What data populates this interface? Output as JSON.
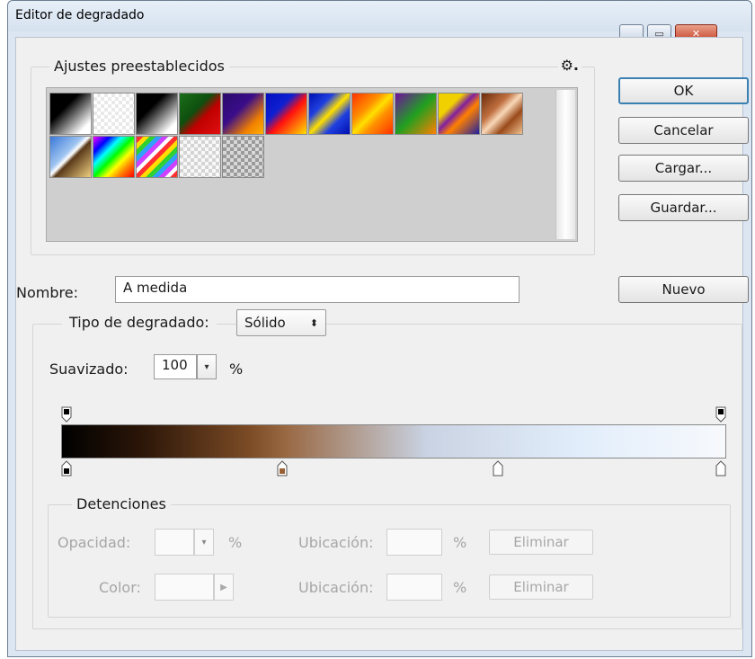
{
  "window": {
    "title": "Editor de degradado"
  },
  "presets": {
    "legend": "Ajustes preestablecidos",
    "swatches": [
      {
        "name": "black-white-preset",
        "bg": "linear-gradient(135deg,#000 35%,#fff 85%)"
      },
      {
        "name": "transparent-preset",
        "bg": "repeating-conic-gradient(#e9e9e9 0 25%, #ffffff 0 50%) 0 0/8px 8px"
      },
      {
        "name": "black-transparent-preset",
        "bg": "linear-gradient(135deg,#000 35%,#ffffff 85%)"
      },
      {
        "name": "red-green-preset",
        "bg": "linear-gradient(135deg,#1a6e1a 0%,#0f4f0f 40%,#c00000 60%,#e01010 100%)"
      },
      {
        "name": "violet-orange-preset",
        "bg": "linear-gradient(135deg,#2a0a6a 0%,#3a0d8a 40%,#f08000 75%,#ffb000 100%)"
      },
      {
        "name": "blue-red-yellow-preset",
        "bg": "linear-gradient(135deg,#0010c0 0%,#1020d0 35%,#ff1010 55%,#ffe000 100%)"
      },
      {
        "name": "blue-yellow-blue-preset",
        "bg": "linear-gradient(135deg,#0010b0 0%,#2040e0 30%,#ffe000 50%,#2040e0 70%,#0010b0 100%)"
      },
      {
        "name": "orange-yellow-orange-preset",
        "bg": "linear-gradient(135deg,#ff3000 0%,#ff9000 35%,#ffe000 50%,#ff9000 65%,#ff3000 100%)"
      },
      {
        "name": "violet-green-orange-preset",
        "bg": "linear-gradient(135deg,#7010a0 0%,#20a020 50%,#ff8000 100%)"
      },
      {
        "name": "yellow-violet-orange-blue-preset",
        "bg": "linear-gradient(135deg,#f0d000 0%,#f0d000 30%,#8020a0 45%,#ff8000 60%,#2020a0 100%)"
      },
      {
        "name": "copper-preset",
        "bg": "linear-gradient(135deg,#6a2a0a 0%,#c07040 35%,#f8d8b8 50%,#9a4a1a 70%,#f0c090 100%)"
      },
      {
        "name": "chrome-preset",
        "bg": "linear-gradient(135deg,#3a78d8 0%,#9fc4f0 40%,#ffffff 48%,#5a3a1a 55%,#f0d080 100%)"
      },
      {
        "name": "spectrum-preset",
        "bg": "linear-gradient(135deg,#ff00ff 0%,#0000ff 20%,#00ffff 35%,#00ff00 50%,#ffff00 65%,#ff8000 80%,#ff0000 100%)"
      },
      {
        "name": "transparent-rainbow-preset",
        "bg": "repeating-linear-gradient(135deg,#ff3030 0 5px,#ffdd00 5px 10px,#30d030 10px 15px,#30a0ff 15px 20px,#d040ff 20px 25px,#ffffff 25px 29px)"
      },
      {
        "name": "transparent-stripes-preset",
        "bg": "repeating-conic-gradient(#d4d4d4 0 25%, #f8f8f8 0 50%) 0 0/8px 8px"
      },
      {
        "name": "neutral-density-preset",
        "bg": "repeating-conic-gradient(#9a9a9a 0 25%, #d8d8d8 0 50%) 0 0/8px 8px"
      }
    ]
  },
  "buttons": {
    "ok": "OK",
    "cancel": "Cancelar",
    "load": "Cargar...",
    "save": "Guardar...",
    "new": "Nuevo"
  },
  "name_field": {
    "label": "Nombre:",
    "value": "A medida"
  },
  "gradient": {
    "type_label": "Tipo de degradado:",
    "type_value": "Sólido",
    "smoothness_label": "Suavizado:",
    "smoothness_value": "100",
    "percent": "%",
    "color_stops": [
      {
        "color": "#000000",
        "position": 0
      },
      {
        "color": "#9a6035",
        "position": 33
      },
      {
        "color": "#ffffff",
        "position": 66
      },
      {
        "color": "#ffffff",
        "position": 100
      }
    ],
    "opacity_stops": [
      {
        "color": "#000000",
        "position": 0
      },
      {
        "color": "#000000",
        "position": 100
      }
    ]
  },
  "stops": {
    "legend": "Detenciones",
    "opacity_label": "Opacidad:",
    "color_label": "Color:",
    "location_label": "Ubicación:",
    "percent": "%",
    "delete_label": "Eliminar"
  }
}
